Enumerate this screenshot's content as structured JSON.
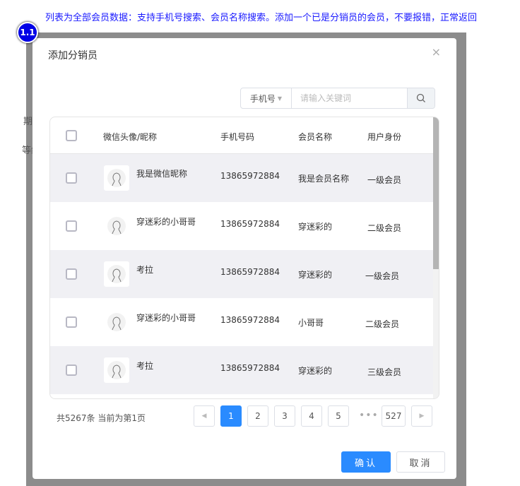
{
  "annotation": {
    "text": "列表为全部会员数据：支持手机号搜索、会员名称搜索。添加一个已是分销员的会员，不要报错，正常返回",
    "badge": "1.1"
  },
  "background": {
    "texts": [
      "期",
      "等级"
    ]
  },
  "modal": {
    "title": "添加分销员",
    "close": "×"
  },
  "search": {
    "type": "手机号",
    "placeholder": "请输入关键词"
  },
  "table": {
    "headers": [
      "微信头像/昵称",
      "手机号码",
      "会员名称",
      "用户身份"
    ],
    "rows": [
      {
        "nickname": "我是微信昵称",
        "phone": "13865972884",
        "name": "我是会员名称",
        "level": "一级会员"
      },
      {
        "nickname": "穿迷彩的小哥哥",
        "phone": "13865972884",
        "name": "穿迷彩的",
        "level": "二级会员"
      },
      {
        "nickname": "考拉",
        "phone": "13865972884",
        "name": "穿迷彩的",
        "level": "一级会员"
      },
      {
        "nickname": "穿迷彩的小哥哥",
        "phone": "13865972884",
        "name": "小哥哥",
        "level": "二级会员"
      },
      {
        "nickname": "考拉",
        "phone": "13865972884",
        "name": "穿迷彩的",
        "level": "三级会员"
      }
    ]
  },
  "pagination": {
    "summary": "共5267条 当前为第1页",
    "pages": [
      "1",
      "2",
      "3",
      "4",
      "5",
      "527"
    ],
    "ellipsis": "•••",
    "current": 1
  },
  "footer": {
    "confirm": "确认",
    "cancel": "取消"
  }
}
